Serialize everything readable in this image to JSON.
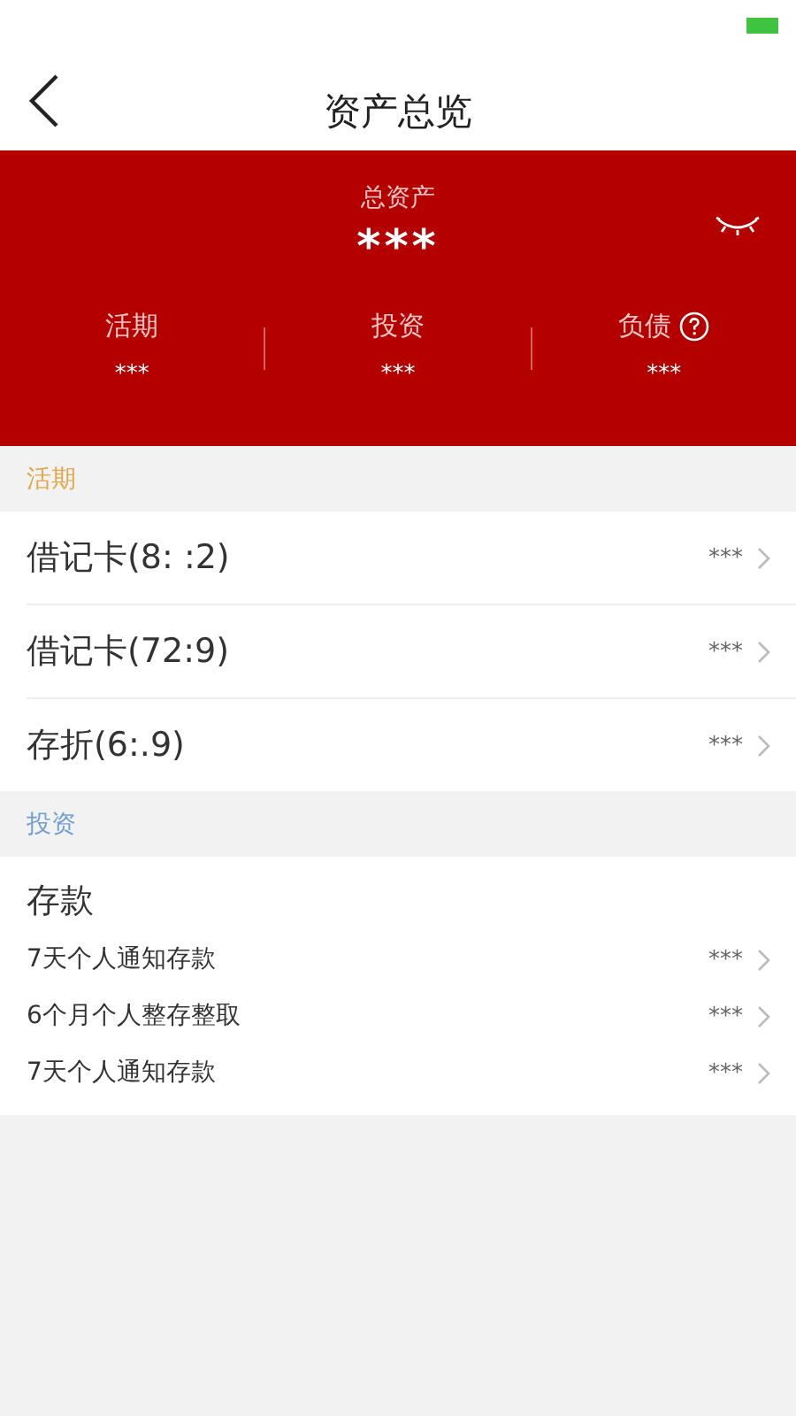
{
  "nav": {
    "title": "资产总览"
  },
  "summary": {
    "label": "总资产",
    "value": "***",
    "columns": [
      {
        "label": "活期",
        "value": "***"
      },
      {
        "label": "投资",
        "value": "***"
      },
      {
        "label": "负债",
        "value": "***",
        "help": true
      }
    ]
  },
  "sections": [
    {
      "title": "活期",
      "color": "#e0a84a",
      "rows": [
        {
          "name": "借记卡(8: :2)",
          "value": "***"
        },
        {
          "name": "借记卡(72:9)",
          "value": "***"
        },
        {
          "name": "存折(6:.9)",
          "value": "***"
        }
      ]
    },
    {
      "title": "投资",
      "color": "#6f9fd6",
      "heading": "存款",
      "rows": [
        {
          "name": "7天个人通知存款",
          "value": "***"
        },
        {
          "name": "6个月个人整存整取",
          "value": "***"
        },
        {
          "name": "7天个人通知存款",
          "value": "***"
        }
      ]
    }
  ]
}
